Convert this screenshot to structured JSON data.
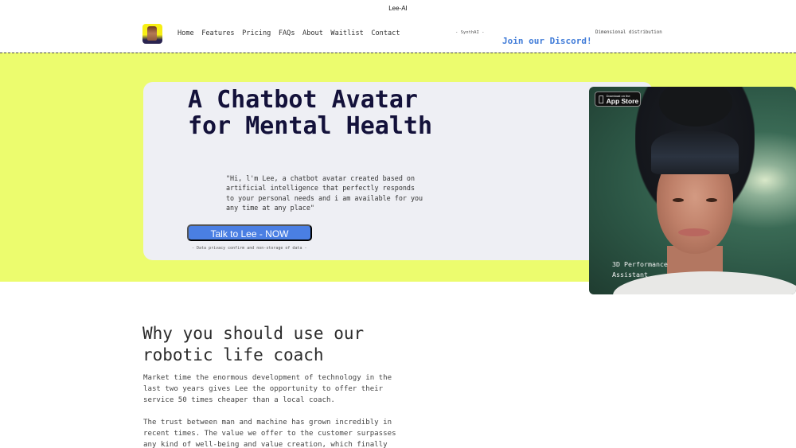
{
  "window": {
    "title": "Lee-AI"
  },
  "nav": {
    "logo_icon": "lee-avatar-logo",
    "links": [
      "Home",
      "Features",
      "Pricing",
      "FAQs",
      "About",
      "Waitlist",
      "Contact"
    ],
    "synth_label": "- SynthAI -",
    "dimensional_label": "Dimensional distribution",
    "discord_label": "Join our Discord!"
  },
  "hero": {
    "title": "A Chatbot Avatar for Mental Health",
    "quote": "\"Hi, l'm Lee, a chatbot avatar created based on artificial intelligence that perfectly responds to your personal needs and i am available for you any time at any place\"",
    "cta_label": "Talk to Lee - NOW",
    "privacy_note": "- Data privacy confirm and non-storage of data -",
    "avatar_card": {
      "appstore_small": "Download on the",
      "appstore_big": "App Store",
      "apple_icon": "apple-icon",
      "caption_line1": "3D Performance",
      "caption_line2": "Assistant"
    }
  },
  "why": {
    "title_line1": "Why you should use our",
    "title_line2": "robotic life coach",
    "paragraph1": "Market time the enormous development of technology in the last two years gives Lee the opportunity to offer their service 50 times cheaper than a local coach.",
    "paragraph2": "The trust between man and machine has grown incredibly in recent times. The value we offer to the customer surpasses any kind of well-being and value creation, which finally"
  },
  "colors": {
    "hero_bg": "#ecfc6e",
    "card_bg": "#eeeff4",
    "accent_blue": "#4a7fe3",
    "title_navy": "#13113a",
    "discord_blue": "#3f7bd8"
  }
}
